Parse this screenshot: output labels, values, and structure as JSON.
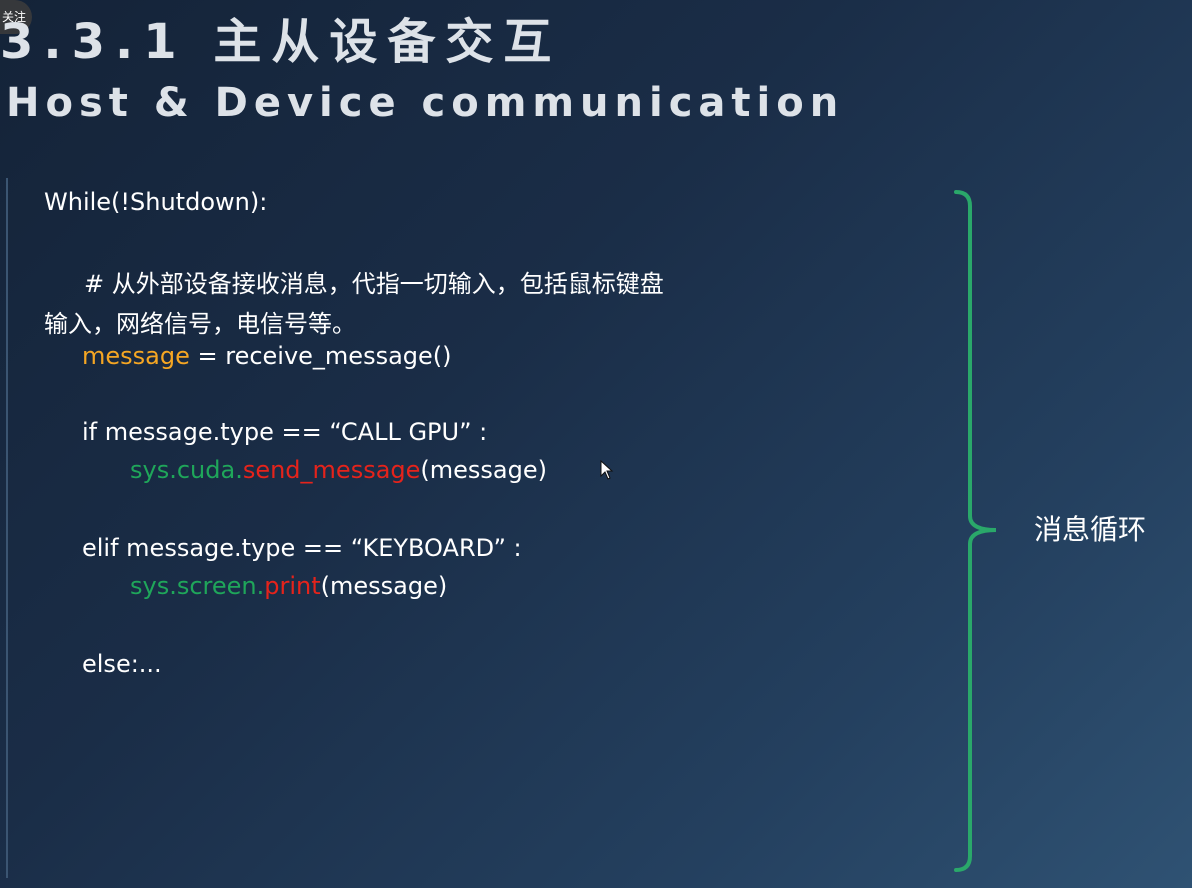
{
  "badge": {
    "label": "关注"
  },
  "title": {
    "chinese": "3.3.1 主从设备交互",
    "english": "Host & Device communication"
  },
  "code": {
    "line_while": "While(!Shutdown):",
    "comment_line1": "# 从外部设备接收消息，代指一切输入，包括鼠标键盘",
    "comment_line2": "输入，网络信号，电信号等。",
    "assign_var": "message",
    "assign_rest": " = receive_message()",
    "if_line": "if message.type ==  “CALL GPU” :",
    "if_call_module": "sys.cuda.",
    "if_call_method": "send_message",
    "if_call_args": "(message)",
    "elif_line": "elif message.type ==  “KEYBOARD” :",
    "elif_call_module": "sys.screen.",
    "elif_call_method": "print",
    "elif_call_args": "(message)",
    "else_line": "else:..."
  },
  "bracket_label": "消息循环",
  "colors": {
    "variable": "#f5a623",
    "module": "#1fa65a",
    "method": "#e5231b",
    "bracket": "#2aa86a"
  }
}
